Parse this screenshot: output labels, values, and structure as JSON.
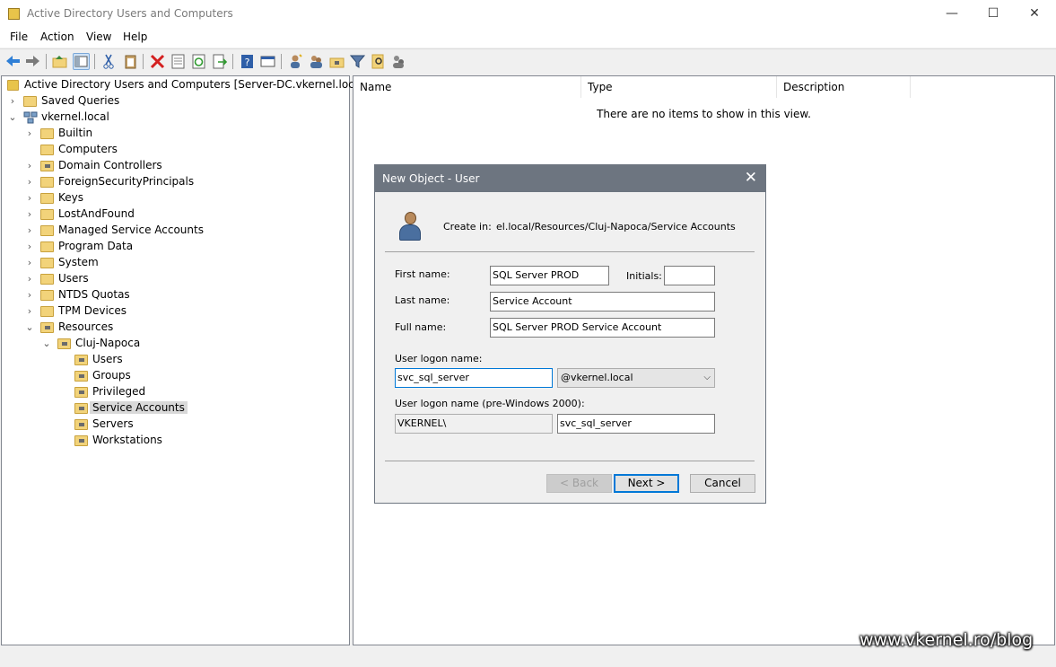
{
  "window": {
    "title": "Active Directory Users and Computers"
  },
  "menu": [
    "File",
    "Action",
    "View",
    "Help"
  ],
  "tree": {
    "root": "Active Directory Users and Computers [Server-DC.vkernel.local]",
    "items": [
      {
        "label": "Saved Queries"
      },
      {
        "label": "vkernel.local"
      },
      {
        "label": "Builtin"
      },
      {
        "label": "Computers"
      },
      {
        "label": "Domain Controllers"
      },
      {
        "label": "ForeignSecurityPrincipals"
      },
      {
        "label": "Keys"
      },
      {
        "label": "LostAndFound"
      },
      {
        "label": "Managed Service Accounts"
      },
      {
        "label": "Program Data"
      },
      {
        "label": "System"
      },
      {
        "label": "Users"
      },
      {
        "label": "NTDS Quotas"
      },
      {
        "label": "TPM Devices"
      },
      {
        "label": "Resources"
      },
      {
        "label": "Cluj-Napoca"
      },
      {
        "label": "Users"
      },
      {
        "label": "Groups"
      },
      {
        "label": "Privileged"
      },
      {
        "label": "Service Accounts"
      },
      {
        "label": "Servers"
      },
      {
        "label": "Workstations"
      }
    ]
  },
  "list": {
    "columns": [
      "Name",
      "Type",
      "Description"
    ],
    "empty_message": "There are no items to show in this view."
  },
  "dialog": {
    "title": "New Object - User",
    "create_in_label": "Create in:",
    "create_in_value": "el.local/Resources/Cluj-Napoca/Service Accounts",
    "first_name_label": "First name:",
    "first_name_value": "SQL Server PROD",
    "initials_label": "Initials:",
    "initials_value": "",
    "last_name_label": "Last name:",
    "last_name_value": "Service Account",
    "full_name_label": "Full name:",
    "full_name_value": "SQL Server PROD Service Account",
    "logon_label": "User logon name:",
    "logon_value": "svc_sql_server",
    "domain_value": "@vkernel.local",
    "pre2000_label": "User logon name (pre-Windows 2000):",
    "pre2000_domain": "VKERNEL\\",
    "pre2000_value": "svc_sql_server",
    "back_label": "< Back",
    "next_label": "Next >",
    "cancel_label": "Cancel"
  },
  "watermark": "www.vkernel.ro/blog"
}
